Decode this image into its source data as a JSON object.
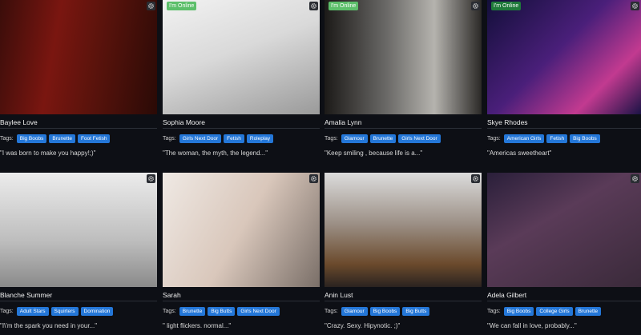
{
  "tags_label": "Tags:",
  "online_label": "I'm Online",
  "cards": [
    {
      "name": "Baylee Love",
      "online": false,
      "tags": [
        "Big Boobs",
        "Brunette",
        "Foot Fetish"
      ],
      "quote": "\"I was born to make you happy!;)\""
    },
    {
      "name": "Sophia Moore",
      "online": true,
      "tags": [
        "Girls Next Door",
        "Fetish",
        "Roleplay"
      ],
      "quote": "\"The woman, the myth, the legend...\""
    },
    {
      "name": "Amalia Lynn",
      "online": true,
      "tags": [
        "Glamour",
        "Brunette",
        "Girls Next Door"
      ],
      "quote": "\"Keep smiling , because life is a...\""
    },
    {
      "name": "Skye Rhodes",
      "online": true,
      "tags": [
        "American Girls",
        "Fetish",
        "Big Boobs"
      ],
      "quote": "\"Americas sweetheart\""
    },
    {
      "name": "Blanche Summer",
      "online": false,
      "tags": [
        "Adult Stars",
        "Squirters",
        "Domination"
      ],
      "quote": "\"I\\'m the spark you need in your...\""
    },
    {
      "name": "Sarah",
      "online": false,
      "tags": [
        "Brunette",
        "Big Butts",
        "Girls Next Door"
      ],
      "quote": "\" light flickers. normal...\""
    },
    {
      "name": "Anin Lust",
      "online": false,
      "tags": [
        "Glamour",
        "Big Boobs",
        "Big Butts"
      ],
      "quote": "\"Crazy. Sexy. Hipynotic. ;)\""
    },
    {
      "name": "Adela Gilbert",
      "online": false,
      "tags": [
        "Big Boobs",
        "College Girls",
        "Brunette"
      ],
      "quote": "\"We can fall in love, probably...\""
    }
  ]
}
